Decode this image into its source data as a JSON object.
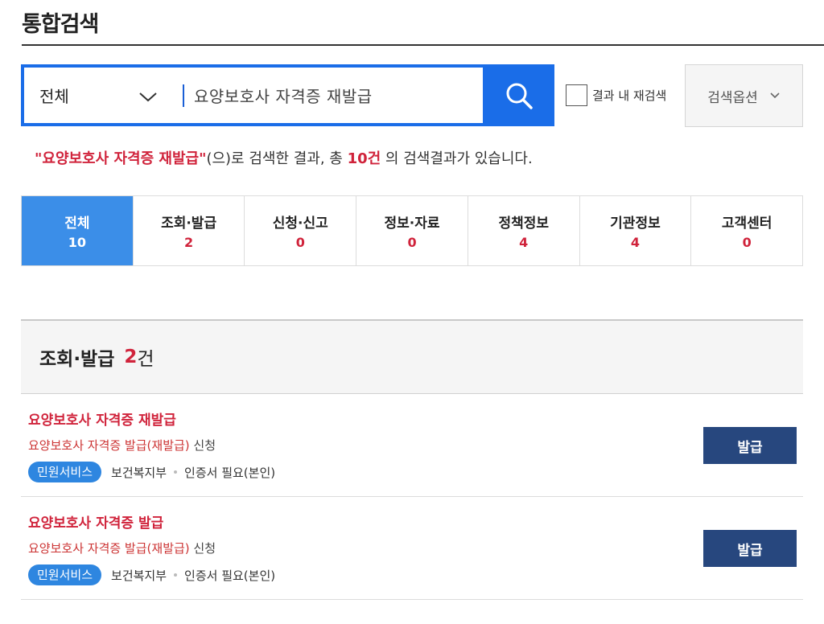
{
  "page": {
    "title": "통합검색"
  },
  "search": {
    "scope": "전체",
    "query": "요양보호사 자격증 재발급",
    "refine_label": "결과 내 재검색",
    "options_label": "검색옵션"
  },
  "summary": {
    "keyword": "\"요양보호사 자격증 재발급\"",
    "text1": "(으)로 검색한 결과, 총 ",
    "count": "10건",
    "text2": " 의 검색결과가 있습니다."
  },
  "tabs": [
    {
      "label": "전체",
      "count": "10"
    },
    {
      "label": "조회·발급",
      "count": "2"
    },
    {
      "label": "신청·신고",
      "count": "0"
    },
    {
      "label": "정보·자료",
      "count": "0"
    },
    {
      "label": "정책정보",
      "count": "4"
    },
    {
      "label": "기관정보",
      "count": "4"
    },
    {
      "label": "고객센터",
      "count": "0"
    }
  ],
  "section": {
    "title": "조회·발급",
    "count": "2",
    "unit": "건"
  },
  "results": [
    {
      "title": "요양보호사 자격증 재발급",
      "desc_highlight": "요양보호사 자격증 발급(재발급)",
      "desc_rest": " 신청",
      "badge": "민원서비스",
      "org": "보건복지부",
      "cert": "인증서 필요(본인)",
      "button": "발급"
    },
    {
      "title": "요양보호사 자격증 발급",
      "desc_highlight": "요양보호사 자격증 발급(재발급)",
      "desc_rest": " 신청",
      "badge": "민원서비스",
      "org": "보건복지부",
      "cert": "인증서 필요(본인)",
      "button": "발급"
    }
  ],
  "colors": {
    "primary_blue": "#1a6de8",
    "tab_active": "#3b8ee8",
    "highlight_red": "#d0233b",
    "issue_button": "#27477e",
    "badge_blue": "#2e86e0"
  },
  "icons": {
    "search": "search-icon",
    "scope_dropdown": "chevron-down-icon",
    "options_dropdown": "chevron-down-icon"
  }
}
